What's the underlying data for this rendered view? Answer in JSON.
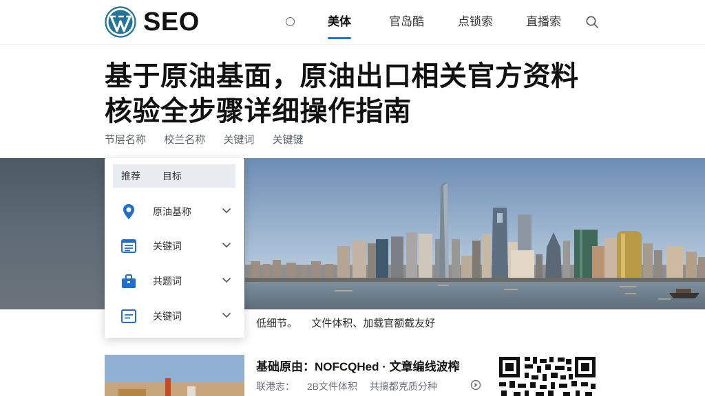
{
  "header": {
    "logo_text": "SEO",
    "nav": [
      {
        "label": "美体",
        "active": true
      },
      {
        "label": "官岛酷",
        "active": false
      },
      {
        "label": "点锁索",
        "active": false
      },
      {
        "label": "直播索",
        "active": false
      }
    ]
  },
  "article": {
    "title_line1": "基于原油基面，原油出口相关官方资料",
    "title_line2": "核验全步骤详细操作指南",
    "tags": [
      "节层名称",
      "校兰名称",
      "关键词",
      "关键键"
    ]
  },
  "panel": {
    "head": [
      "推荐",
      "目标"
    ],
    "items": [
      {
        "label": "原油基称",
        "icon": "location-pin-icon"
      },
      {
        "label": "关键词",
        "icon": "document-list-icon"
      },
      {
        "label": "共题词",
        "icon": "briefcase-icon"
      },
      {
        "label": "关键词",
        "icon": "note-icon"
      }
    ]
  },
  "caption": [
    "低细节。",
    "文件体积、",
    "加载官额截友好"
  ],
  "related": {
    "title": "基础原由：NOFCQHed · 文章编线波榨",
    "meta": [
      "联港志：",
      "2B文件体积",
      "共搞都克质分种"
    ]
  },
  "colors": {
    "accent": "#1a73e8",
    "wordpress_blue": "#21759b",
    "panel_head_bg": "#e9edf2"
  }
}
